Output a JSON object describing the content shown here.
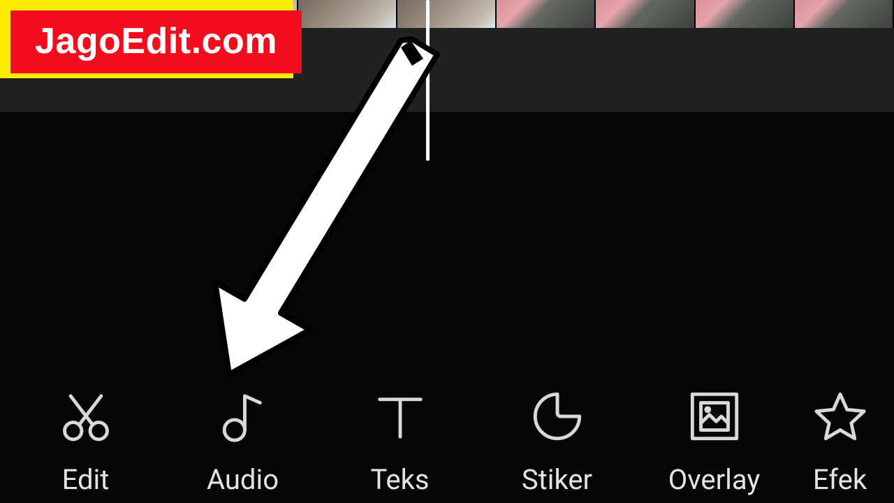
{
  "watermark": {
    "label": "JagoEdit.com"
  },
  "toolbar": {
    "items": [
      {
        "id": "edit",
        "label": "Edit",
        "icon": "scissors-icon"
      },
      {
        "id": "audio",
        "label": "Audio",
        "icon": "music-note-icon"
      },
      {
        "id": "teks",
        "label": "Teks",
        "icon": "text-icon"
      },
      {
        "id": "stiker",
        "label": "Stiker",
        "icon": "sticker-icon"
      },
      {
        "id": "overlay",
        "label": "Overlay",
        "icon": "overlay-icon"
      },
      {
        "id": "efek",
        "label": "Efek",
        "icon": "star-icon"
      }
    ]
  },
  "arrow_target": "audio"
}
